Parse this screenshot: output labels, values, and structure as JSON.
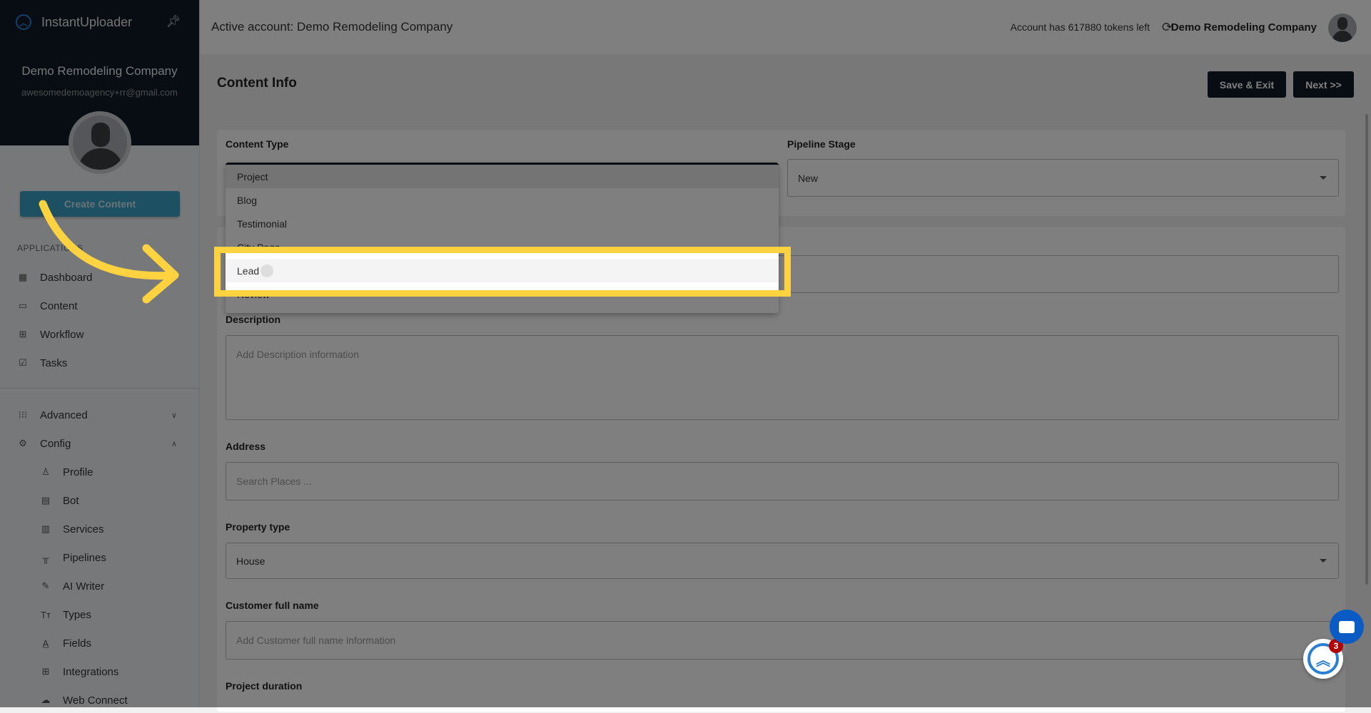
{
  "app": {
    "name": "InstantUploader"
  },
  "sidebar": {
    "company": "Demo Remodeling Company",
    "email": "awesomedemoagency+rr@gmail.com",
    "create_label": "Create Content",
    "section_label": "APPLICATIONS",
    "items": [
      {
        "label": "Dashboard",
        "icon": "dashboard-icon"
      },
      {
        "label": "Content",
        "icon": "folder-icon"
      },
      {
        "label": "Workflow",
        "icon": "grid-icon"
      },
      {
        "label": "Tasks",
        "icon": "checkbox-icon"
      },
      {
        "label": "Advanced",
        "icon": "apps-icon"
      },
      {
        "label": "Config",
        "icon": "gear-icon"
      }
    ],
    "config_items": [
      {
        "label": "Profile"
      },
      {
        "label": "Bot"
      },
      {
        "label": "Services"
      },
      {
        "label": "Pipelines"
      },
      {
        "label": "AI Writer"
      },
      {
        "label": "Types"
      },
      {
        "label": "Fields"
      },
      {
        "label": "Integrations"
      },
      {
        "label": "Web Connect"
      }
    ]
  },
  "header": {
    "title": "Active account: Demo Remodeling Company",
    "tokens": "Account has 617880 tokens left",
    "company": "Demo Remodeling Company"
  },
  "page": {
    "title": "Content Info",
    "save_label": "Save & Exit",
    "next_label": "Next >>"
  },
  "form": {
    "content_type": {
      "label": "Content Type",
      "options": [
        "Project",
        "Blog",
        "Testimonial",
        "City Page",
        "Lead",
        "Review"
      ],
      "selected": "Project",
      "hovered": "Lead"
    },
    "pipeline_stage": {
      "label": "Pipeline Stage",
      "value": "New"
    },
    "description": {
      "label": "Description",
      "placeholder": "Add Description information"
    },
    "address": {
      "label": "Address",
      "placeholder": "Search Places ..."
    },
    "property_type": {
      "label": "Property type",
      "value": "House"
    },
    "customer_name": {
      "label": "Customer full name",
      "placeholder": "Add Customer full name information"
    },
    "project_duration": {
      "label": "Project duration"
    }
  },
  "widgets": {
    "badge_count": "3"
  },
  "colors": {
    "highlight": "#ffd23f",
    "brand_dark": "#0e1a25",
    "accent": "#3ba1c6"
  }
}
